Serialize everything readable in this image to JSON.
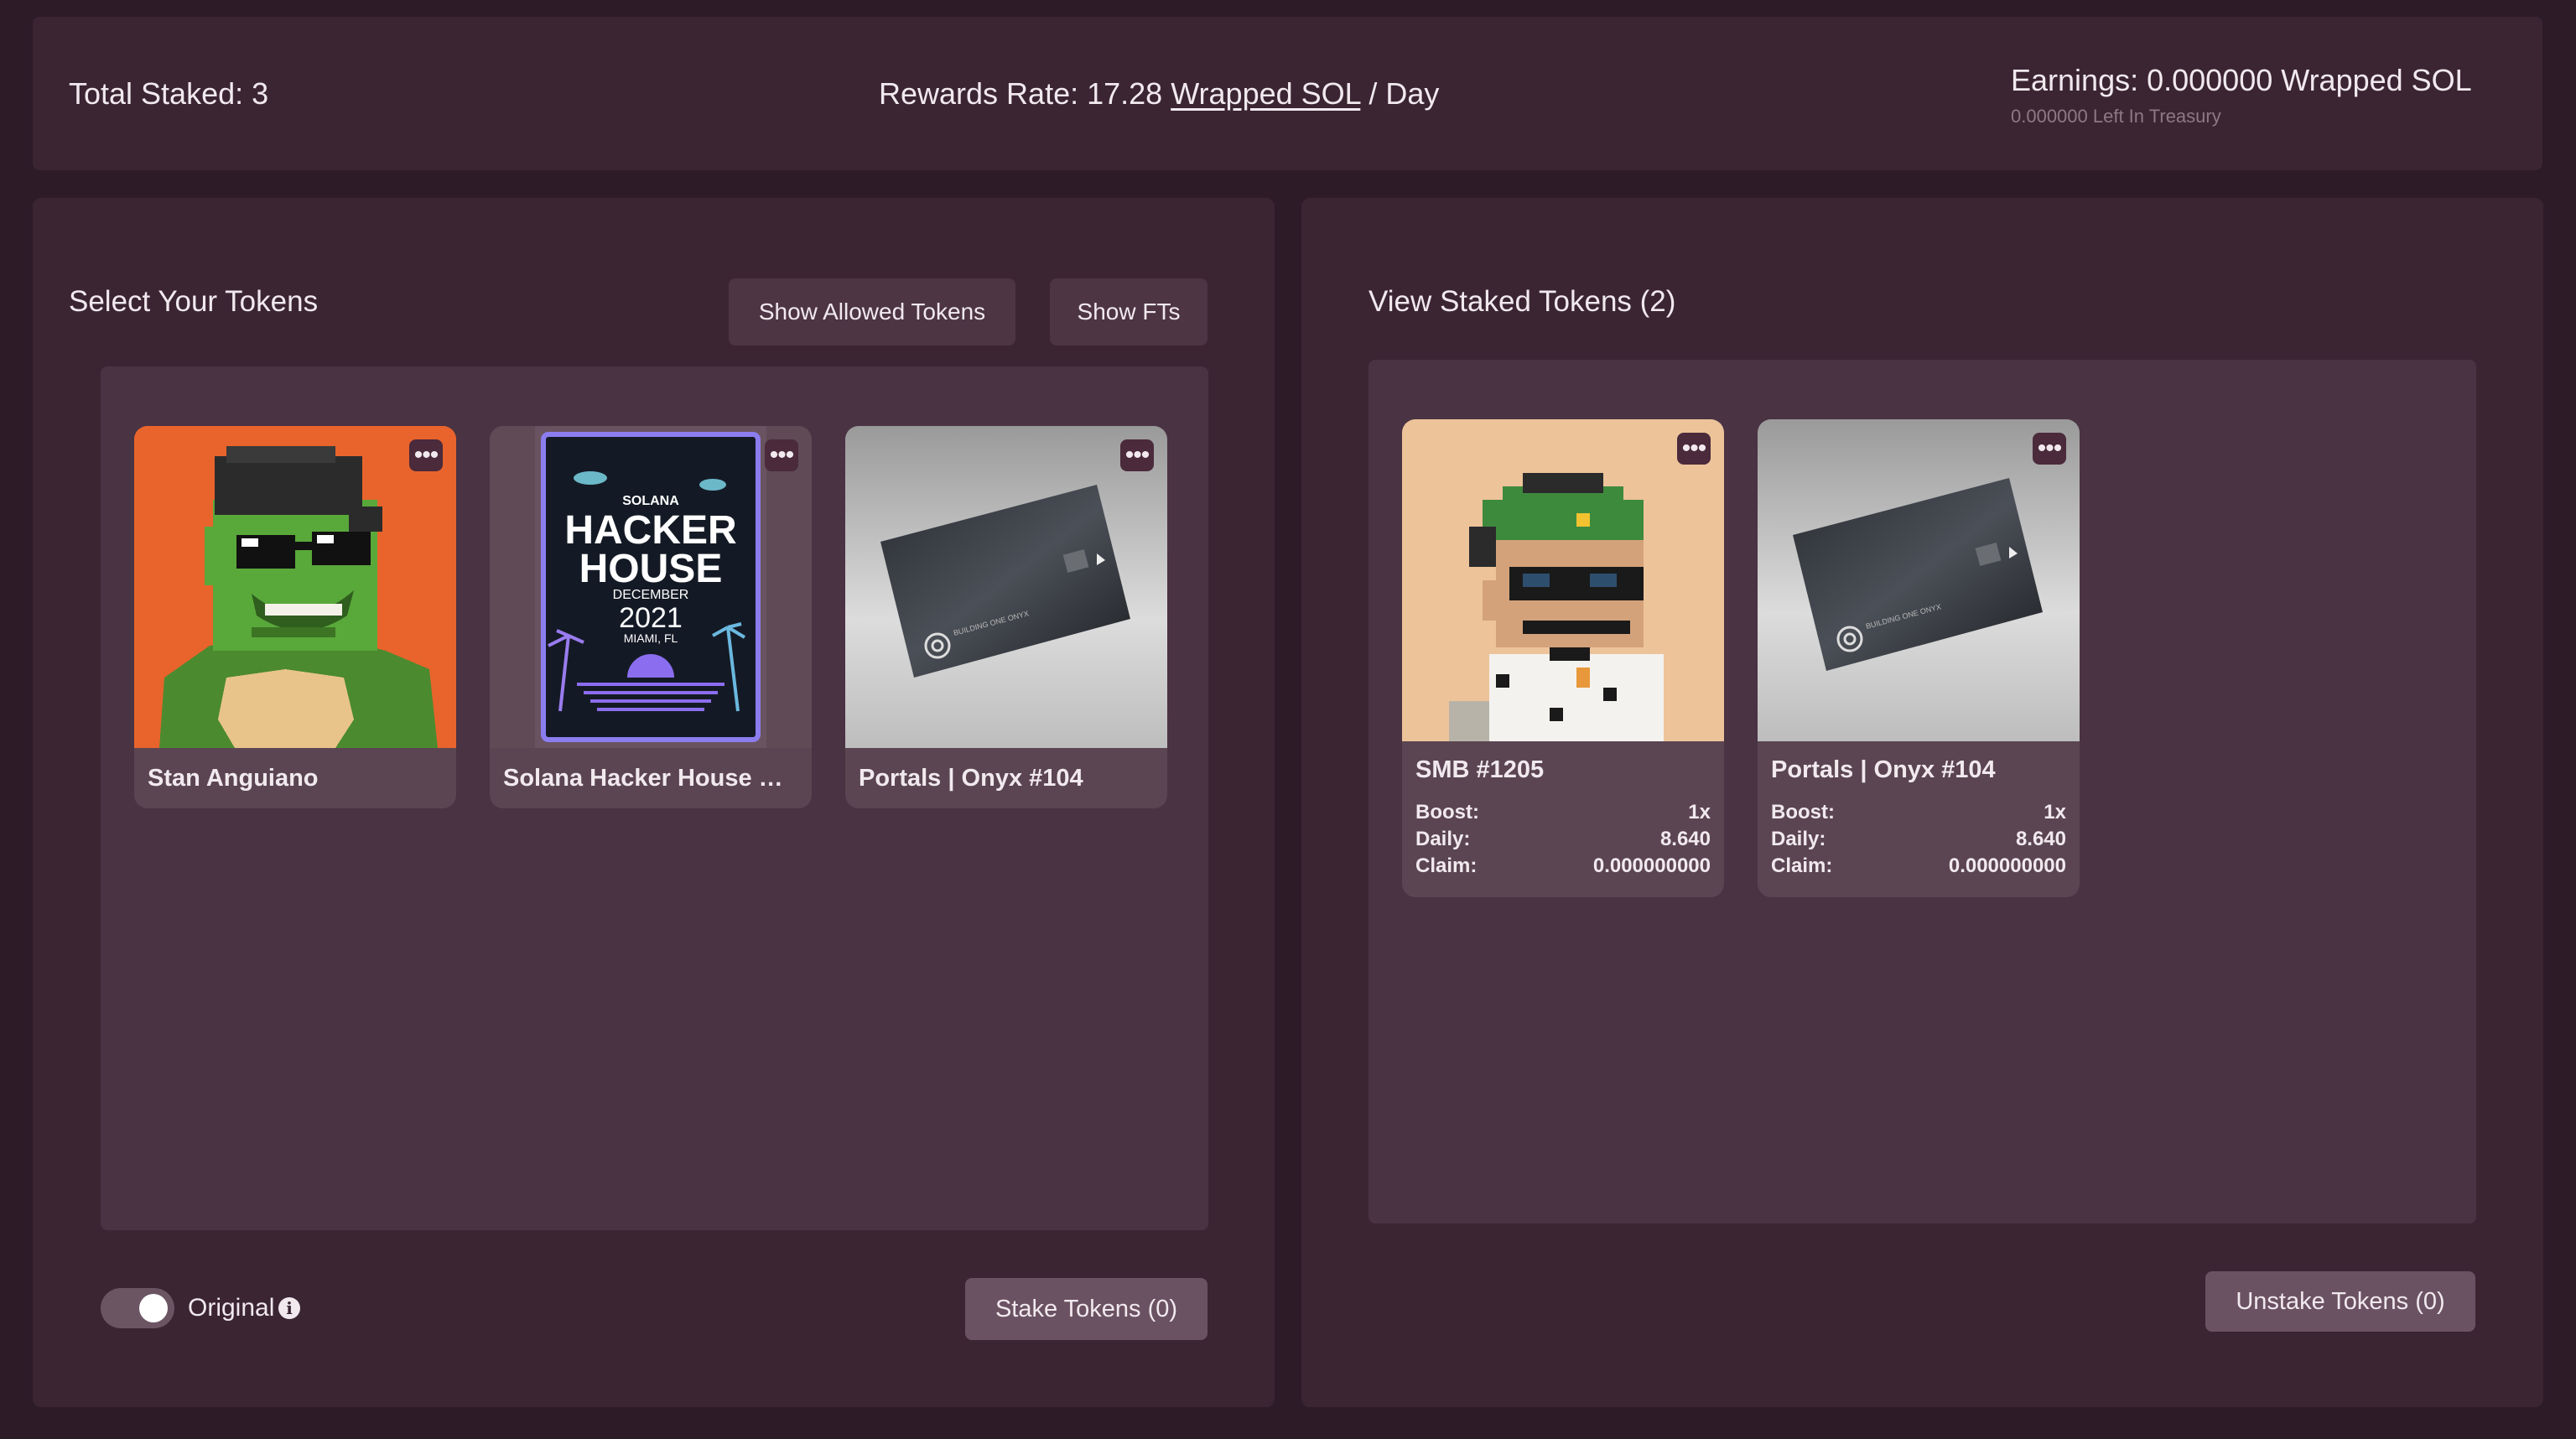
{
  "header": {
    "total_staked": "Total Staked: 3",
    "rewards_prefix": "Rewards Rate: 17.28",
    "rewards_token": "Wrapped SOL",
    "rewards_suffix": "/ Day",
    "earnings": "Earnings: 0.000000 Wrapped SOL",
    "treasury": "0.000000 Left In Treasury"
  },
  "left_panel": {
    "title": "Select Your Tokens",
    "show_allowed_label": "Show Allowed Tokens",
    "show_fts_label": "Show FTs",
    "tokens": [
      {
        "name": "Stan Anguiano",
        "icon": "frog-pfp-image"
      },
      {
        "name": "Solana Hacker House Mi...",
        "icon": "hacker-house-poster-image",
        "poster": {
          "brand": "SOLANA",
          "line1": "HACKER",
          "line2": "HOUSE",
          "month": "DECEMBER",
          "year": "2021",
          "place": "MIAMI, FL"
        }
      },
      {
        "name": "Portals | Onyx #104",
        "icon": "onyx-card-image",
        "card_text": "BUILDING ONE ONYX"
      }
    ],
    "toggle_label": "Original",
    "stake_label": "Stake Tokens (0)"
  },
  "right_panel": {
    "title": "View Staked Tokens (2)",
    "tokens": [
      {
        "name": "SMB #1205",
        "icon": "smb-monkey-image",
        "boost_label": "Boost:",
        "boost": "1x",
        "daily_label": "Daily:",
        "daily": "8.640",
        "claim_label": "Claim:",
        "claim": "0.000000000"
      },
      {
        "name": "Portals | Onyx #104",
        "icon": "onyx-card-image",
        "card_text": "BUILDING ONE ONYX",
        "boost_label": "Boost:",
        "boost": "1x",
        "daily_label": "Daily:",
        "daily": "8.640",
        "claim_label": "Claim:",
        "claim": "0.000000000"
      }
    ],
    "unstake_label": "Unstake Tokens (0)"
  },
  "colors": {
    "background": "#2d1b28",
    "panel": "#3b2533",
    "inner": "#4a3343",
    "card": "#5b4552",
    "orange_bg": "#e86a32",
    "peach_bg": "#edc39a"
  }
}
